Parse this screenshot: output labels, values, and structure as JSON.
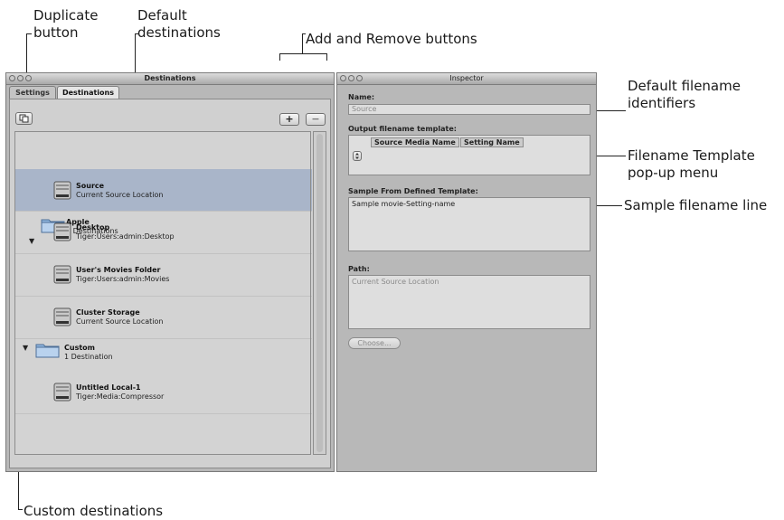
{
  "annotations": {
    "duplicate": [
      "Duplicate",
      "button"
    ],
    "default_dest": [
      "Default",
      "destinations"
    ],
    "add_remove": "Add and Remove buttons",
    "default_filename": [
      "Default filename",
      "identifiers"
    ],
    "template_menu": [
      "Filename Template",
      "pop-up menu"
    ],
    "sample_line": "Sample filename line",
    "custom_dest": "Custom destinations"
  },
  "destinations_window": {
    "title": "Destinations",
    "tabs": [
      "Settings",
      "Destinations"
    ],
    "active_tab": "Destinations",
    "duplicate_icon": "duplicate-icon",
    "add_label": "+",
    "remove_label": "−",
    "groups": [
      {
        "name": "Apple",
        "count": "4 Destinations",
        "icon": "folder-icon",
        "expanded": true
      },
      {
        "name": "Custom",
        "count": "1 Destination",
        "icon": "folder-icon",
        "expanded": true
      }
    ],
    "items": [
      {
        "name": "Source",
        "path": "Current Source Location",
        "icon": "disk-icon",
        "selected": true
      },
      {
        "name": "Desktop",
        "path": "Tiger:Users:admin:Desktop",
        "icon": "disk-icon"
      },
      {
        "name": "User's Movies Folder",
        "path": "Tiger:Users:admin:Movies",
        "icon": "disk-icon"
      },
      {
        "name": "Cluster Storage",
        "path": "Current Source Location",
        "icon": "disk-icon"
      },
      {
        "name": "Untitled Local-1",
        "path": "Tiger:Media:Compressor",
        "icon": "disk-icon"
      }
    ]
  },
  "inspector_window": {
    "title": "Inspector",
    "name_label": "Name:",
    "name_value": "Source",
    "output_label": "Output filename template:",
    "tokens": [
      "Source Media Name",
      "Setting Name"
    ],
    "popup_icon": "popup-arrows-icon",
    "sample_label": "Sample From Defined Template:",
    "sample_value": "Sample movie-Setting-name",
    "path_label": "Path:",
    "path_value": "Current Source Location",
    "choose_label": "Choose..."
  },
  "colors": {
    "selection": "#a9b5c9",
    "window_bg": "#b8b8b8",
    "folder": "#8fb4dd"
  }
}
